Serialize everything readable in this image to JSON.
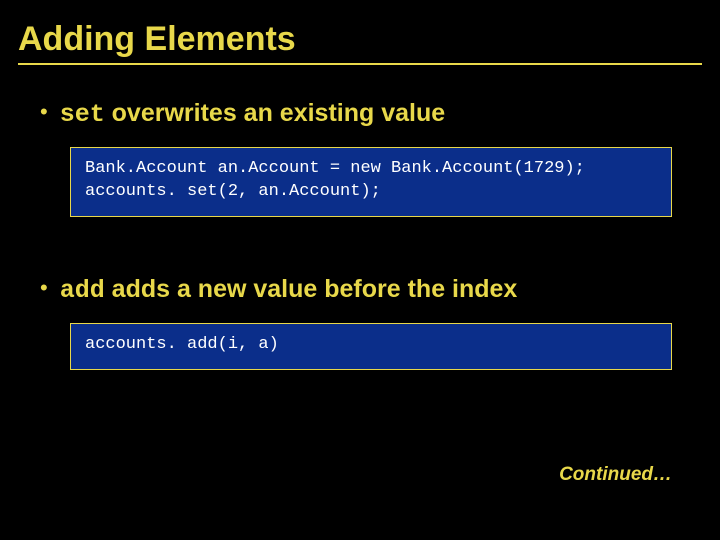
{
  "title": "Adding Elements",
  "bullets": [
    {
      "code": "set",
      "rest": " overwrites an existing value",
      "codeLines": [
        "Bank.Account an.Account = new Bank.Account(1729);",
        "accounts. set(2, an.Account);"
      ]
    },
    {
      "code": "add",
      "rest": " adds a new value before the index",
      "codeLines": [
        "accounts. add(i, a)"
      ]
    }
  ],
  "continued": "Continued…"
}
